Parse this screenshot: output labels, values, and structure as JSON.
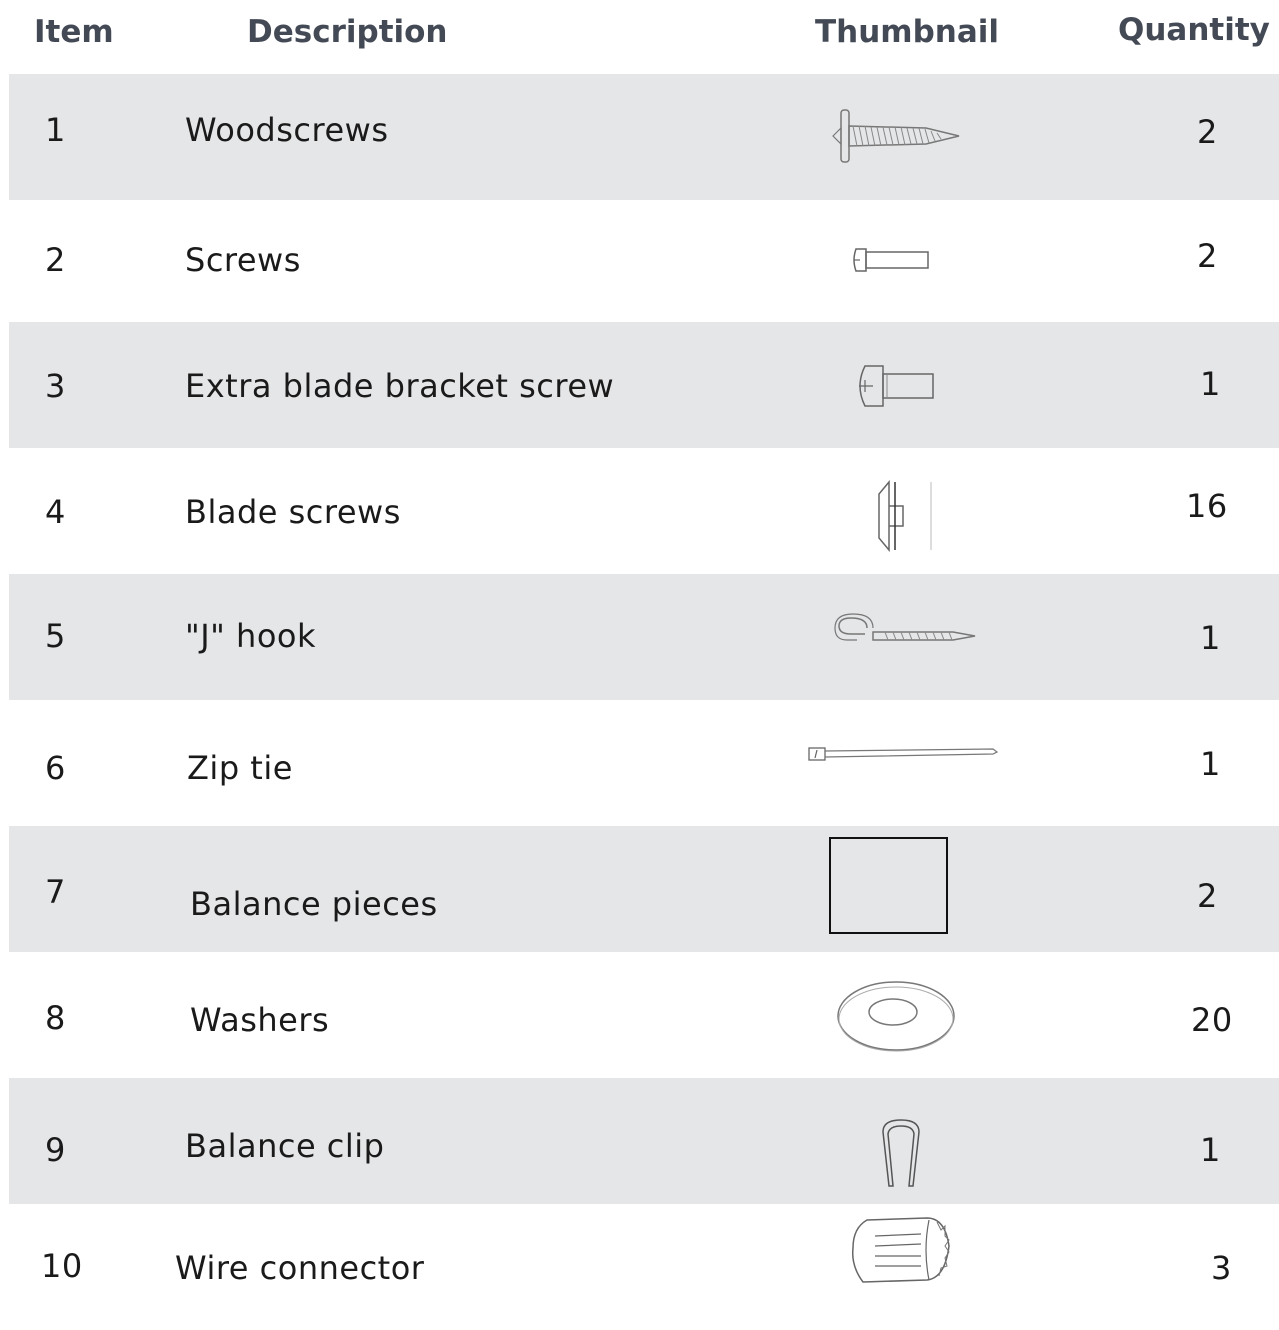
{
  "headers": {
    "item": "Item",
    "description": "Description",
    "thumbnail": "Thumbnail",
    "quantity": "Quantity"
  },
  "rows": [
    {
      "item": "1",
      "description": "Woodscrews",
      "quantity": "2",
      "icon": "woodscrew-icon"
    },
    {
      "item": "2",
      "description": "Screws",
      "quantity": "2",
      "icon": "screw-icon"
    },
    {
      "item": "3",
      "description": "Extra blade bracket screw",
      "quantity": "1",
      "icon": "bracket-screw-icon"
    },
    {
      "item": "4",
      "description": "Blade screws",
      "quantity": "16",
      "icon": "blade-screw-icon"
    },
    {
      "item": "5",
      "description": "\"J\" hook",
      "quantity": "1",
      "icon": "j-hook-icon"
    },
    {
      "item": "6",
      "description": "Zip tie",
      "quantity": "1",
      "icon": "zip-tie-icon"
    },
    {
      "item": "7",
      "description": "Balance pieces",
      "quantity": "2",
      "icon": "balance-piece-icon"
    },
    {
      "item": "8",
      "description": "Washers",
      "quantity": "20",
      "icon": "washer-icon"
    },
    {
      "item": "9",
      "description": "Balance clip",
      "quantity": "1",
      "icon": "balance-clip-icon"
    },
    {
      "item": "10",
      "description": "Wire connector",
      "quantity": "3",
      "icon": "wire-connector-icon"
    }
  ],
  "colors": {
    "header_text": "#444a55",
    "row_shade": "#e5e6e8",
    "body_text": "#1a1a1a"
  }
}
